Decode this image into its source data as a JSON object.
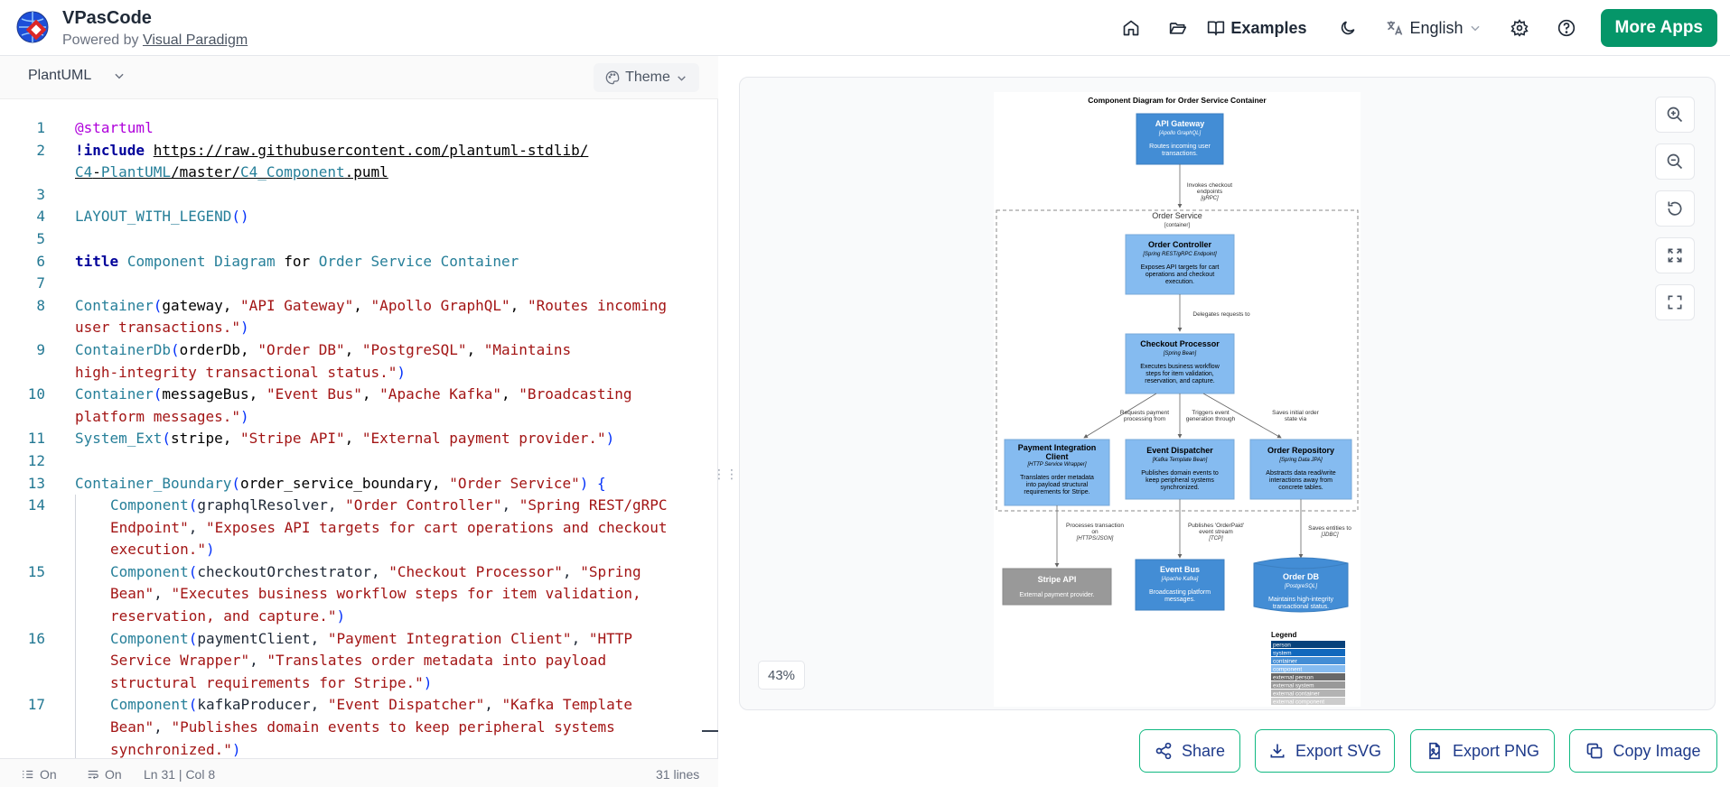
{
  "header": {
    "app_name": "VPasCode",
    "powered_prefix": "Powered by",
    "powered_link": "Visual Paradigm",
    "nav": {
      "home_icon": "home-icon",
      "folder_icon": "folder-icon",
      "examples_label": "Examples",
      "theme_toggle_icon": "moon-icon",
      "language_label": "English",
      "settings_icon": "gear-icon",
      "help_icon": "help-icon",
      "more_apps_label": "More Apps"
    }
  },
  "editor": {
    "language_label": "PlantUML",
    "theme_label": "Theme",
    "status": {
      "wrap_label": "On",
      "format_label": "On",
      "cursor_position": "Ln 31 | Col 8",
      "line_count": "31 lines"
    },
    "lines": [
      {
        "n": "1"
      },
      {
        "n": "2"
      },
      {
        "n": "3"
      },
      {
        "n": "4"
      },
      {
        "n": "5"
      },
      {
        "n": "6"
      },
      {
        "n": "7"
      },
      {
        "n": "8"
      },
      {
        "n": "9"
      },
      {
        "n": "10"
      },
      {
        "n": "11"
      },
      {
        "n": "12"
      },
      {
        "n": "13"
      },
      {
        "n": "14"
      },
      {
        "n": "15"
      },
      {
        "n": "16"
      },
      {
        "n": "17"
      }
    ]
  },
  "preview": {
    "zoom_level": "43%",
    "controls": [
      "zoom-in-icon",
      "zoom-out-icon",
      "reset-icon",
      "fit-icon",
      "fullscreen-icon"
    ],
    "diagram": {
      "title": "Component Diagram for Order Service Container",
      "boundary_label": "Order Service",
      "boundary_type": "[container]",
      "gateway": {
        "name": "API Gateway",
        "tech": "[Apollo GraphQL]",
        "desc": "Routes incoming user transactions."
      },
      "controller": {
        "name": "Order Controller",
        "tech": "[Spring REST/gRPC Endpoint]",
        "desc": "Exposes API targets for cart operations and checkout execution."
      },
      "processor": {
        "name": "Checkout Processor",
        "tech": "[Spring Bean]",
        "desc": "Executes business workflow steps for item validation, reservation, and capture."
      },
      "payment": {
        "name": "Payment Integration Client",
        "tech": "[HTTP Service Wrapper]",
        "desc": "Translates order metadata into payload structural requirements for Stripe."
      },
      "dispatcher": {
        "name": "Event Dispatcher",
        "tech": "[Kafka Template Bean]",
        "desc": "Publishes domain events to keep peripheral systems synchronized."
      },
      "repository": {
        "name": "Order Repository",
        "tech": "[Spring Data JPA]",
        "desc": "Abstracts data read/write interactions away from concrete tables."
      },
      "stripe": {
        "name": "Stripe API",
        "desc": "External payment provider."
      },
      "bus": {
        "name": "Event Bus",
        "tech": "[Apache Kafka]",
        "desc": "Broadcasting platform messages."
      },
      "db": {
        "name": "Order DB",
        "tech": "[PostgreSQL]",
        "desc": "Maintains high-integrity transactional status."
      },
      "rel_gateway": "Invokes checkout endpoints",
      "rel_gateway_tech": "[gRPC]",
      "rel_delegate": "Delegates requests to",
      "rel_payment": "Requests payment processing from",
      "rel_event": "Triggers event generation through",
      "rel_repo": "Saves initial order state via",
      "rel_stripe": "Processes transaction on",
      "rel_stripe_tech": "[HTTPS/JSON]",
      "rel_bus": "Publishes 'OrderPaid' event stream",
      "rel_bus_tech": "[TCP]",
      "rel_db": "Saves entities to",
      "rel_db_tech": "[JDBC]",
      "legend_title": "Legend",
      "legend_items": [
        "person",
        "system",
        "container",
        "component",
        "external person",
        "external system",
        "external container",
        "external component"
      ],
      "legend_colors": [
        "#08427b",
        "#1168bd",
        "#438dd5",
        "#85bbf0",
        "#686868",
        "#999999",
        "#b3b3b3",
        "#cccccc"
      ]
    }
  },
  "actions": {
    "share": "Share",
    "export_svg": "Export SVG",
    "export_png": "Export PNG",
    "copy_image": "Copy Image"
  }
}
